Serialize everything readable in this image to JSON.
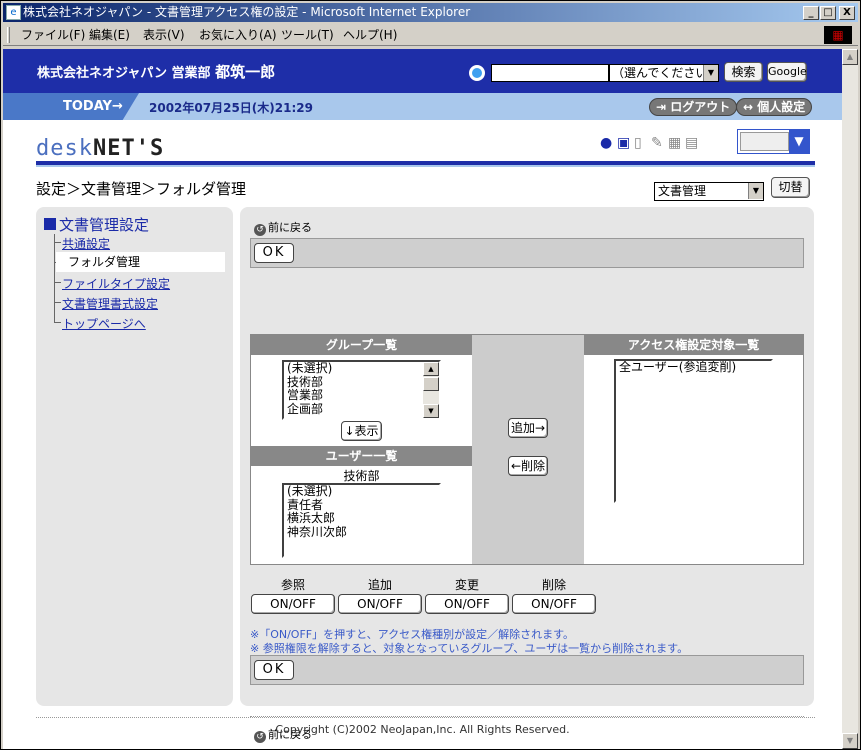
{
  "window": {
    "title": "株式会社ネオジャパン - 文書管理アクセス権の設定 - Microsoft Internet Explorer",
    "min_label": "_",
    "max_label": "□",
    "close_label": "X"
  },
  "menubar": {
    "items": [
      "ファイル(F)",
      "編集(E)",
      "表示(V)",
      "お気に入り(A)",
      "ツール(T)",
      "ヘルプ(H)"
    ]
  },
  "header": {
    "company": "株式会社ネオジャパン",
    "dept": "営業部",
    "user": "都筑一郎",
    "search_value": "",
    "search_select": "（選んでください）",
    "search_button": "検索",
    "google_button": "Google"
  },
  "todaybar": {
    "today_label": "TODAY→",
    "date": "2002年07月25日(木)21:29",
    "logout": "ログアウト",
    "personal": "個人設定"
  },
  "logo": {
    "part1": "desk",
    "part2": "NET'S"
  },
  "breadcrumb": "設定＞文書管理＞フォルダ管理",
  "module_select": {
    "value": "文書管理",
    "switch_button": "切替"
  },
  "sidebar": {
    "title": "文書管理設定",
    "items": [
      {
        "label": "共通設定",
        "current": false
      },
      {
        "label": "フォルダ管理",
        "current": true
      },
      {
        "label": "ファイルタイプ設定",
        "current": false
      },
      {
        "label": "文書管理書式設定",
        "current": false
      },
      {
        "label": "トップページへ",
        "current": false
      }
    ]
  },
  "main": {
    "back_label": "前に戻る",
    "ok_label": "OK",
    "group_header": "グループ一覧",
    "groups": [
      "(未選択)",
      "技術部",
      "営業部",
      "企画部"
    ],
    "show_button": "↓表示",
    "user_header": "ユーザー一覧",
    "user_group_label": "技術部",
    "users": [
      "(未選択)",
      "責任者",
      "横浜太郎",
      "神奈川次郎"
    ],
    "add_button": "追加→",
    "remove_button": "←削除",
    "access_header": "アクセス権設定対象一覧",
    "access_items": [
      "全ユーザー(参追変削)"
    ],
    "perm_labels": [
      "参照",
      "追加",
      "変更",
      "削除"
    ],
    "onoff_label": "ON/OFF",
    "note1": "※「ON/OFF」を押すと、アクセス権種別が設定／解除されます。",
    "note2": "※ 参照権限を解除すると、対象となっているグループ、ユーザは一覧から削除されます。"
  },
  "footer": {
    "copyright": "Copyright (C)2002 NeoJapan,Inc. All Rights Reserved."
  }
}
